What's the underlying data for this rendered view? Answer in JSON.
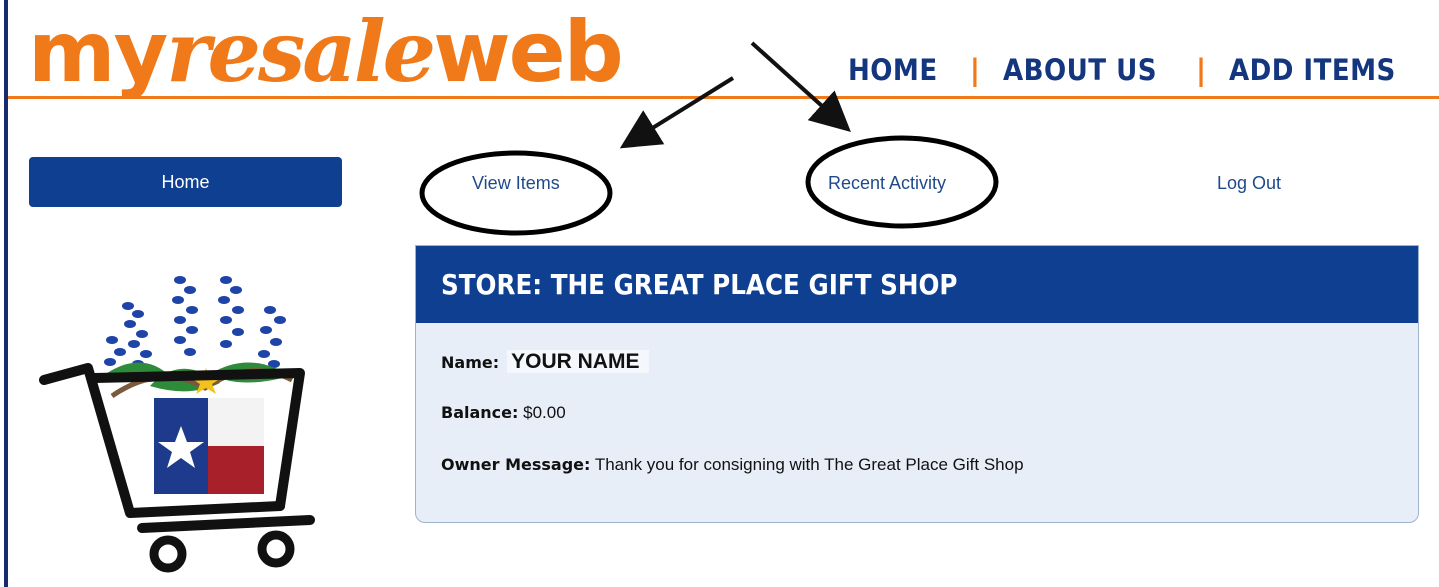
{
  "logo": {
    "part1": "my",
    "part2": "resale",
    "part3": "web"
  },
  "top_nav": {
    "home": "HOME",
    "sep": "|",
    "about": "ABOUT US",
    "add": "ADD ITEMS"
  },
  "sub_nav": {
    "home": "Home",
    "view_items": "View Items",
    "recent_activity": "Recent Activity",
    "log_out": "Log Out"
  },
  "store": {
    "title": "STORE: THE GREAT PLACE GIFT SHOP",
    "name_label": "Name:",
    "name_value": "YOUR NAME",
    "balance_label": "Balance:",
    "balance_value": "$0.00",
    "message_label": "Owner Message:",
    "message_value": "Thank you for consigning with The Great Place Gift Shop"
  },
  "colors": {
    "orange": "#f07a1a",
    "navy": "#0e3f91",
    "panel": "#e7eef7"
  },
  "illustration": "shopping-cart-with-bluebonnets-and-texas-flag",
  "annotation_icons": [
    "arrow-to-view-items",
    "arrow-to-recent-activity",
    "circle-highlight"
  ]
}
